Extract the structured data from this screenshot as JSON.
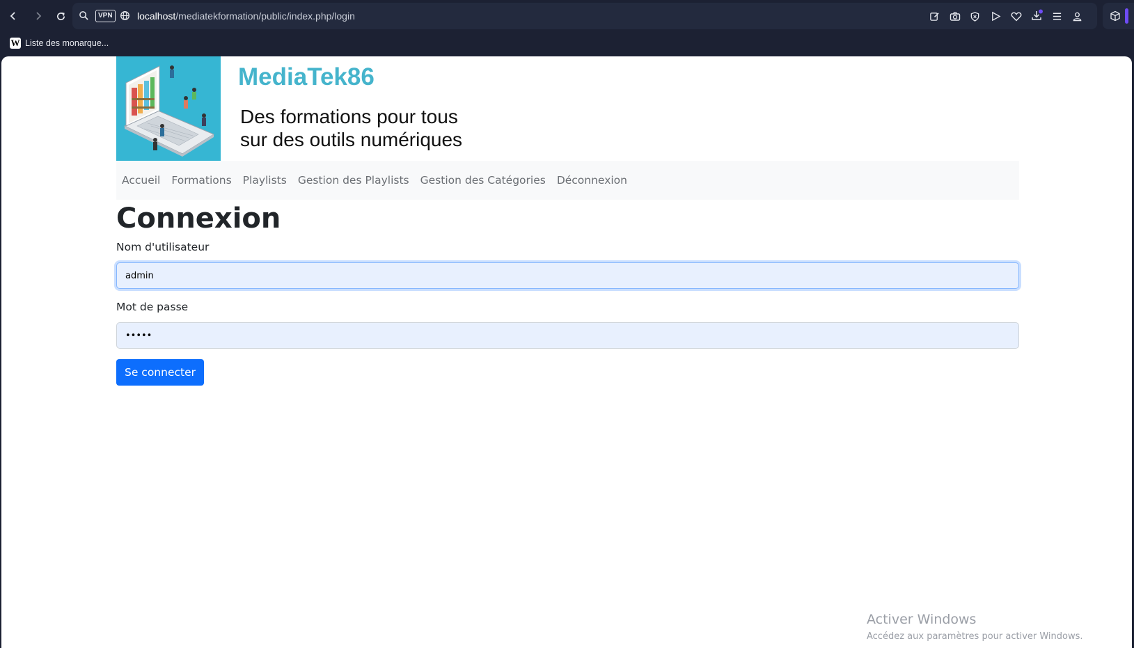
{
  "browser": {
    "url_host": "localhost",
    "url_path": "/mediatekformation/public/index.php/login",
    "vpn_label": "VPN",
    "bookmark_label": "Liste des monarque...",
    "bookmark_icon_letter": "W"
  },
  "site": {
    "title": "MediaTek86",
    "tagline_line1": "Des formations pour tous",
    "tagline_line2": "sur des outils numériques",
    "title_color": "#45b4cc",
    "banner_color": "#36b6d3"
  },
  "nav": {
    "items": [
      {
        "label": "Accueil"
      },
      {
        "label": "Formations"
      },
      {
        "label": "Playlists"
      },
      {
        "label": "Gestion des Playlists"
      },
      {
        "label": "Gestion des Catégories"
      },
      {
        "label": "Déconnexion"
      }
    ]
  },
  "login": {
    "heading": "Connexion",
    "username_label": "Nom d'utilisateur",
    "username_value": "admin",
    "password_label": "Mot de passe",
    "password_value": "admin",
    "submit_label": "Se connecter",
    "button_color": "#0d6efd"
  },
  "watermark": {
    "title": "Activer Windows",
    "subtitle": "Accédez aux paramètres pour activer Windows."
  }
}
